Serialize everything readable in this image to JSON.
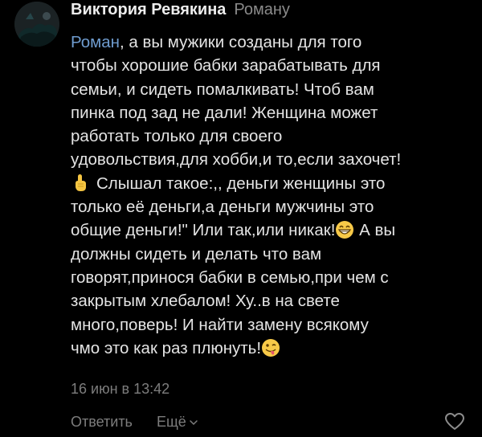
{
  "comment": {
    "author": "Виктория Ревякина",
    "reply_to": "Роману",
    "mention": "Роман",
    "lines": {
      "l1": ", а вы мужики созданы для того",
      "l2": "чтобы хорошие бабки зарабатывать для",
      "l3": "семьи, и сидеть помалкивать! Чтоб вам",
      "l4": "пинка под зад не дали! Женщина может",
      "l5": "работать только для своего",
      "l6": "удовольствия,для хобби,и то,если захочет!",
      "l7": "Слышал такое:,, деньги женщины это",
      "l8": "только её деньги,а деньги мужчины это",
      "l9a": "общие деньги!\" Или так,или никак!",
      "l9b": " А вы",
      "l10": "должны сидеть и делать что вам",
      "l11": "говорят,принося бабки в семью,при чем с",
      "l12": "закрытым хлебалом! Ху..в на свете",
      "l13": "много,поверь! И найти замену всякому",
      "l14": "чмо это как раз плюнуть!"
    },
    "emojis": {
      "pointer": "backhand-index-pointing-down",
      "grin": "grinning-face-with-smiling-eyes",
      "wink": "winking-face-with-tongue"
    },
    "timestamp": "16 июн в 13:42"
  },
  "actions": {
    "reply_label": "Ответить",
    "more_label": "Ещё",
    "like_icon": "heart-outline-icon"
  },
  "colors": {
    "background": "#000000",
    "text": "#e4e4e4",
    "mention": "#6f9ccf",
    "muted": "#7d7d7d"
  }
}
